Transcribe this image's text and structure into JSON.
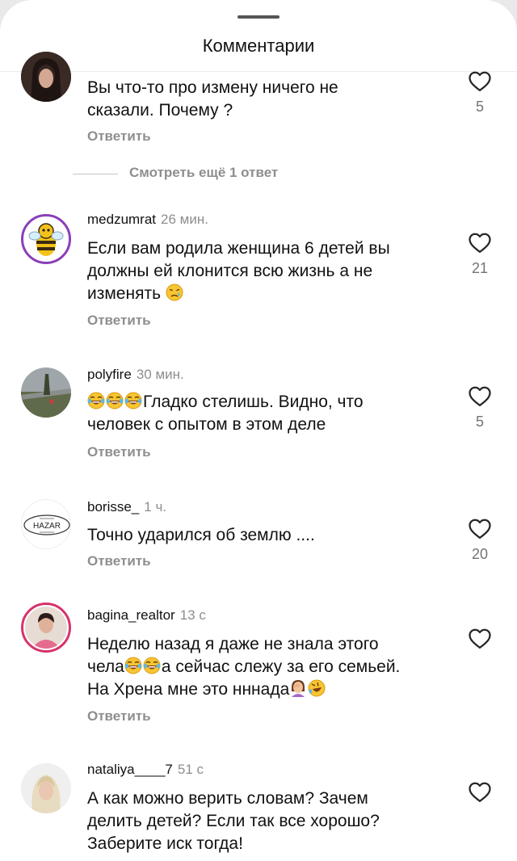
{
  "header": {
    "title": "Комментарии"
  },
  "comments": [
    {
      "username": "",
      "time": "",
      "lines": [
        "Вы что-то про измену ничего не",
        "сказали. Почему ?"
      ],
      "reply_label": "Ответить",
      "likes": "5"
    },
    {
      "username": "medzumrat",
      "time": "26 мин.",
      "lines": [
        "Если вам родила женщина 6 детей вы",
        "должны ей клонится всю жизнь а не",
        "изменять"
      ],
      "reply_label": "Ответить",
      "likes": "21"
    },
    {
      "username": "polyfire",
      "time": "30 мин.",
      "lines": [
        "Гладко стелишь. Видно, что",
        "человек с опытом в этом деле"
      ],
      "reply_label": "Ответить",
      "likes": "5"
    },
    {
      "username": "borisse_",
      "time": "1 ч.",
      "lines": [
        "Точно ударился об землю ...."
      ],
      "reply_label": "Ответить",
      "likes": "20",
      "avatar_logo_text": "HAZAR"
    },
    {
      "username": "bagina_realtor",
      "time": "13 с",
      "lines": [
        "Неделю назад я даже не знала этого",
        "чела",
        "а сейчас слежу за его семьей.",
        "На Хрена мне это нннада"
      ],
      "reply_label": "Ответить",
      "likes": ""
    },
    {
      "username": "nataliya____7",
      "time": "51 с",
      "lines": [
        "А как можно верить словам? Зачем",
        "делить детей? Если так все хорошо?",
        "Заберите иск тогда!"
      ],
      "reply_label": "",
      "likes": ""
    }
  ],
  "more_replies": {
    "label": "Смотреть ещё 1 ответ"
  },
  "icons": {
    "like": "heart-outline-icon"
  },
  "colors": {
    "secondary_text": "#8e8e8e",
    "primary_text": "#111111",
    "background": "#ffffff"
  }
}
